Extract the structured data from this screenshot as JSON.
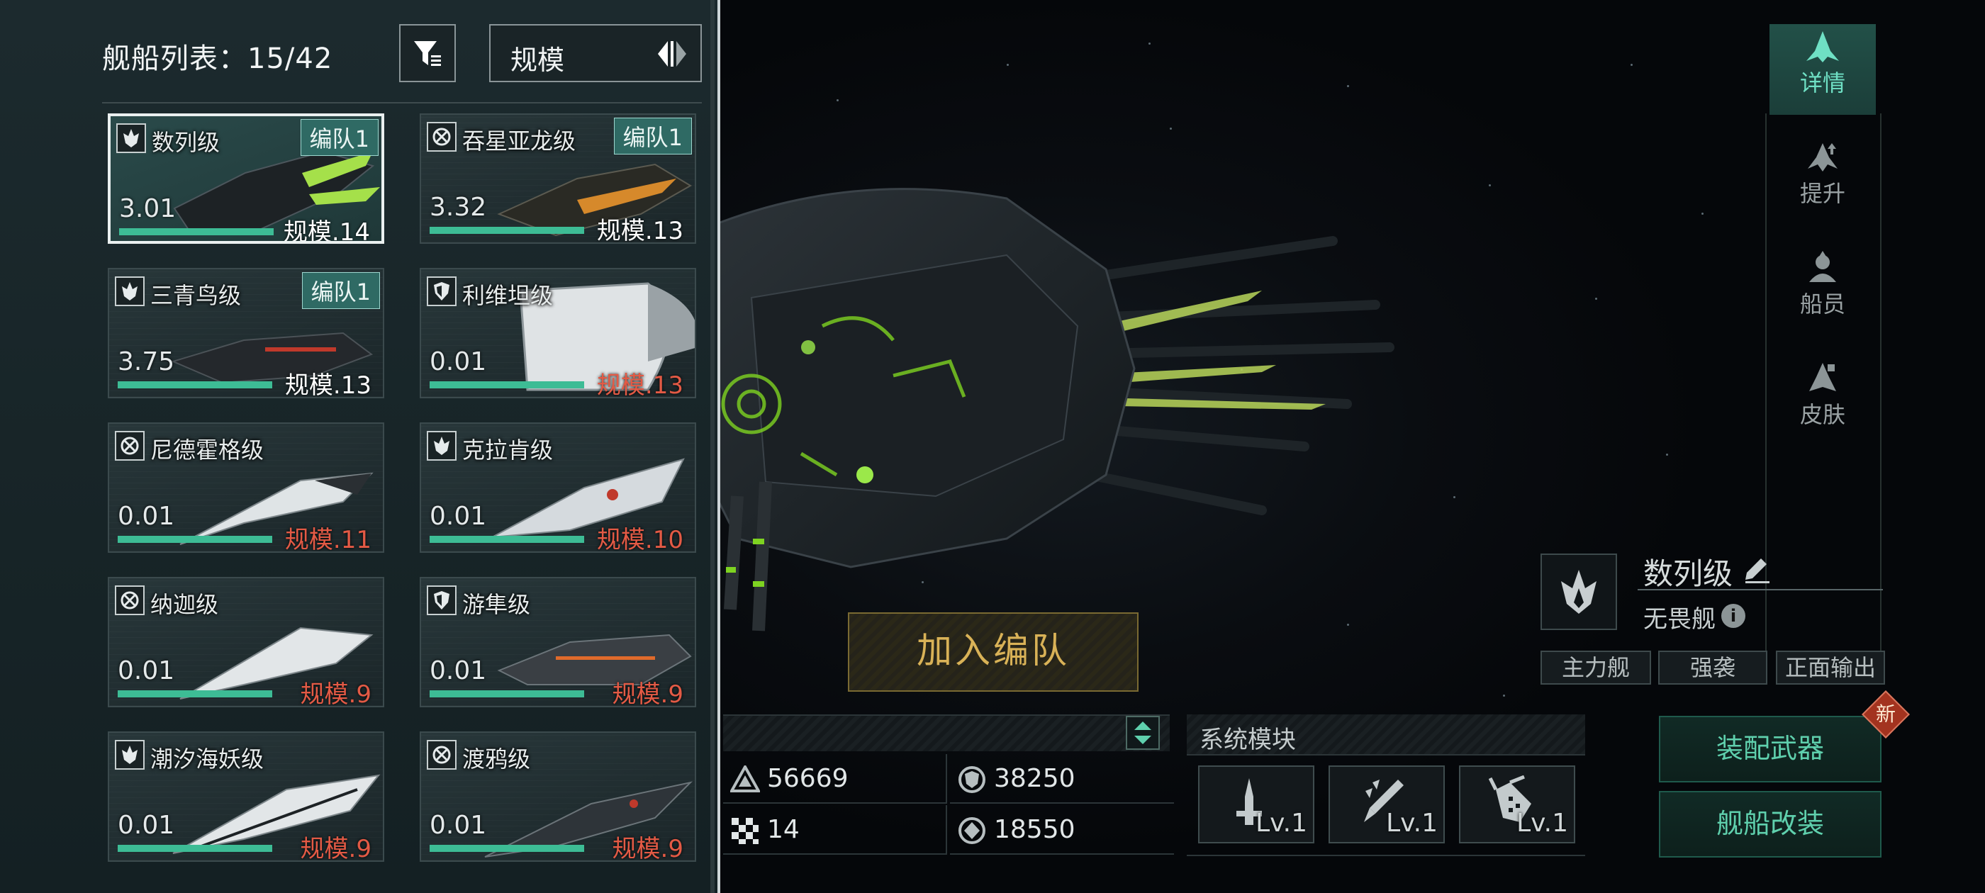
{
  "fleet_list": {
    "title": "舰船列表：15/42",
    "filter_icon": "filter-icon",
    "sort_label": "规模",
    "ships": [
      {
        "name": "数列级",
        "class_icon": "flame-icon",
        "power": "3.01",
        "scale": "规模.14",
        "fleet": "编队1",
        "selected": true,
        "scale_warning": false,
        "bar_fraction": 1.0
      },
      {
        "name": "吞星亚龙级",
        "class_icon": "target-icon",
        "power": "3.32",
        "scale": "规模.13",
        "fleet": "编队1",
        "selected": false,
        "scale_warning": false,
        "bar_fraction": 1.0
      },
      {
        "name": "三青鸟级",
        "class_icon": "flame-icon",
        "power": "3.75",
        "scale": "规模.13",
        "fleet": "编队1",
        "selected": false,
        "scale_warning": false,
        "bar_fraction": 1.0
      },
      {
        "name": "利维坦级",
        "class_icon": "shield-icon",
        "power": "0.01",
        "scale": "规模.13",
        "fleet": "",
        "selected": false,
        "scale_warning": true,
        "bar_fraction": 1.0
      },
      {
        "name": "尼德霍格级",
        "class_icon": "target-icon",
        "power": "0.01",
        "scale": "规模.11",
        "fleet": "",
        "selected": false,
        "scale_warning": true,
        "bar_fraction": 1.0
      },
      {
        "name": "克拉肯级",
        "class_icon": "flame-icon",
        "power": "0.01",
        "scale": "规模.10",
        "fleet": "",
        "selected": false,
        "scale_warning": true,
        "bar_fraction": 1.0
      },
      {
        "name": "纳迦级",
        "class_icon": "target-icon",
        "power": "0.01",
        "scale": "规模.9",
        "fleet": "",
        "selected": false,
        "scale_warning": true,
        "bar_fraction": 1.0
      },
      {
        "name": "游隼级",
        "class_icon": "shield-icon",
        "power": "0.01",
        "scale": "规模.9",
        "fleet": "",
        "selected": false,
        "scale_warning": true,
        "bar_fraction": 1.0
      },
      {
        "name": "潮汐海妖级",
        "class_icon": "flame-icon",
        "power": "0.01",
        "scale": "规模.9",
        "fleet": "",
        "selected": false,
        "scale_warning": true,
        "bar_fraction": 1.0
      },
      {
        "name": "渡鸦级",
        "class_icon": "target-icon",
        "power": "0.01",
        "scale": "规模.9",
        "fleet": "",
        "selected": false,
        "scale_warning": true,
        "bar_fraction": 1.0
      }
    ]
  },
  "tabs": [
    {
      "label": "详情",
      "icon": "ship-detail-icon",
      "active": true
    },
    {
      "label": "提升",
      "icon": "upgrade-icon",
      "active": false
    },
    {
      "label": "船员",
      "icon": "crew-icon",
      "active": false
    },
    {
      "label": "皮肤",
      "icon": "skin-icon",
      "active": false
    }
  ],
  "ship_info": {
    "name": "数列级",
    "type": "无畏舰",
    "tags": [
      "主力舰",
      "强袭",
      "正面输出"
    ]
  },
  "join_fleet_label": "加入编队",
  "stats": [
    {
      "icon": "armor-icon",
      "value": "56669"
    },
    {
      "icon": "shield-stat-icon",
      "value": "38250"
    },
    {
      "icon": "checker-icon",
      "value": "14"
    },
    {
      "icon": "energy-icon",
      "value": "18550"
    }
  ],
  "modules": {
    "title": "系统模块",
    "items": [
      {
        "icon": "tower-module-icon",
        "level": "Lv.1"
      },
      {
        "icon": "missile-module-icon",
        "level": "Lv.1"
      },
      {
        "icon": "turret-module-icon",
        "level": "Lv.1"
      }
    ]
  },
  "actions": {
    "equip_label": "装配武器",
    "modify_label": "舰船改装",
    "new_badge": "新"
  },
  "colors": {
    "accent_green": "#3dbc95",
    "warn_red": "#e35a45",
    "gold": "#d9b257",
    "teal_text": "#5fd0ad"
  }
}
